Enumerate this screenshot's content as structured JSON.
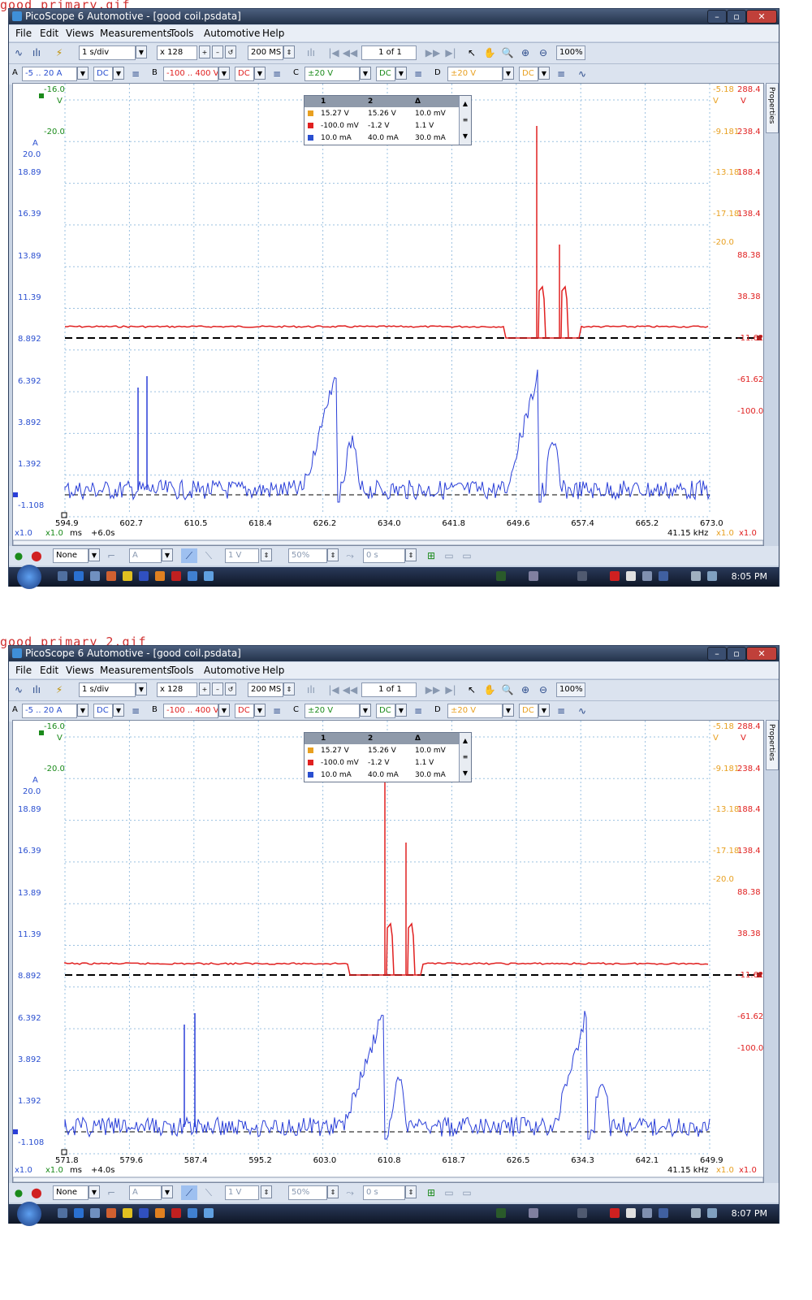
{
  "shots": [
    {
      "caption": "good_primary.gif",
      "window_title": "PicoScope 6 Automotive - [good coil.psdata]",
      "menu": [
        "File",
        "Edit",
        "Views",
        "Measurements",
        "Tools",
        "Automotive",
        "Help"
      ],
      "toolbar": {
        "timebase": "1 s/div",
        "zoom": "x 128",
        "samples": "200 MS",
        "page": "1 of 1",
        "zoom_pct": "100%"
      },
      "channels": {
        "a_range": "-5 .. 20 A",
        "a_coupling": "DC",
        "b_range": "-100 .. 400 V",
        "b_coupling": "DC",
        "c_range": "±20 V",
        "c_coupling": "DC",
        "d_range": "±20 V",
        "d_coupling": "DC"
      },
      "left_axis_top": {
        "green_val": "-16.0",
        "green_unit": "V",
        "green_20": "-20.0",
        "blue_unit": "A",
        "blue_20": "20.0"
      },
      "left_ticks": [
        "18.89",
        "16.39",
        "13.89",
        "11.39",
        "8.892",
        "6.392",
        "3.892",
        "1.392",
        "-1.108"
      ],
      "right_ticks_orange": [
        "-5.18",
        "-9.181",
        "-13.18",
        "-17.18",
        "-20.0"
      ],
      "right_unit_orange": "V",
      "right_ticks_red": [
        "288.4",
        "238.4",
        "188.4",
        "138.4",
        "88.38",
        "38.38",
        "-11.62",
        "-61.62",
        "-100.0"
      ],
      "right_unit_red": "V",
      "x_ticks": [
        "594.9",
        "602.7",
        "610.5",
        "618.4",
        "626.2",
        "634.0",
        "641.8",
        "649.6",
        "657.4",
        "665.2",
        "673.0"
      ],
      "x_unit": "ms",
      "x_offset": "+6.0s",
      "scale_a": "x1.0",
      "scale_b": "x1.0",
      "scale_c": "x1.0",
      "scale_d": "x1.0",
      "freq": "41.15 kHz",
      "measurements": {
        "headers": [
          "1",
          "2",
          "Δ"
        ],
        "rows": [
          {
            "color": "#e8a020",
            "c1": "15.27 V",
            "c2": "15.26 V",
            "d": "10.0 mV"
          },
          {
            "color": "#e02020",
            "c1": "-100.0 mV",
            "c2": "-1.2 V",
            "d": "1.1 V"
          },
          {
            "color": "#2a4fd0",
            "c1": "10.0 mA",
            "c2": "40.0 mA",
            "d": "30.0 mA"
          }
        ]
      },
      "trigger_mode": "None",
      "trigger_channel": "A",
      "trigger_level": "1 V",
      "trigger_pct": "50%",
      "trigger_delay": "0 s",
      "clock": "8:05 PM"
    },
    {
      "caption": "good_primary_2.gif",
      "window_title": "PicoScope 6 Automotive - [good coil.psdata]",
      "menu": [
        "File",
        "Edit",
        "Views",
        "Measurements",
        "Tools",
        "Automotive",
        "Help"
      ],
      "toolbar": {
        "timebase": "1 s/div",
        "zoom": "x 128",
        "samples": "200 MS",
        "page": "1 of 1",
        "zoom_pct": "100%"
      },
      "channels": {
        "a_range": "-5 .. 20 A",
        "a_coupling": "DC",
        "b_range": "-100 .. 400 V",
        "b_coupling": "DC",
        "c_range": "±20 V",
        "c_coupling": "DC",
        "d_range": "±20 V",
        "d_coupling": "DC"
      },
      "left_axis_top": {
        "green_val": "-16.0",
        "green_unit": "V",
        "green_20": "-20.0",
        "blue_unit": "A",
        "blue_20": "20.0"
      },
      "left_ticks": [
        "18.89",
        "16.39",
        "13.89",
        "11.39",
        "8.892",
        "6.392",
        "3.892",
        "1.392",
        "-1.108"
      ],
      "right_ticks_orange": [
        "-5.18",
        "-9.181",
        "-13.18",
        "-17.18",
        "-20.0"
      ],
      "right_unit_orange": "V",
      "right_ticks_red": [
        "288.4",
        "238.4",
        "188.4",
        "138.4",
        "88.38",
        "38.38",
        "-11.62",
        "-61.62",
        "-100.0"
      ],
      "right_unit_red": "V",
      "x_ticks": [
        "571.8",
        "579.6",
        "587.4",
        "595.2",
        "603.0",
        "610.8",
        "618.7",
        "626.5",
        "634.3",
        "642.1",
        "649.9"
      ],
      "x_unit": "ms",
      "x_offset": "+4.0s",
      "scale_a": "x1.0",
      "scale_b": "x1.0",
      "scale_c": "x1.0",
      "scale_d": "x1.0",
      "freq": "41.15 kHz",
      "measurements": {
        "headers": [
          "1",
          "2",
          "Δ"
        ],
        "rows": [
          {
            "color": "#e8a020",
            "c1": "15.27 V",
            "c2": "15.26 V",
            "d": "10.0 mV"
          },
          {
            "color": "#e02020",
            "c1": "-100.0 mV",
            "c2": "-1.2 V",
            "d": "1.1 V"
          },
          {
            "color": "#2a4fd0",
            "c1": "10.0 mA",
            "c2": "40.0 mA",
            "d": "30.0 mA"
          }
        ]
      },
      "trigger_mode": "None",
      "trigger_channel": "A",
      "trigger_level": "1 V",
      "trigger_pct": "50%",
      "trigger_delay": "0 s",
      "clock": "8:07 PM"
    }
  ]
}
